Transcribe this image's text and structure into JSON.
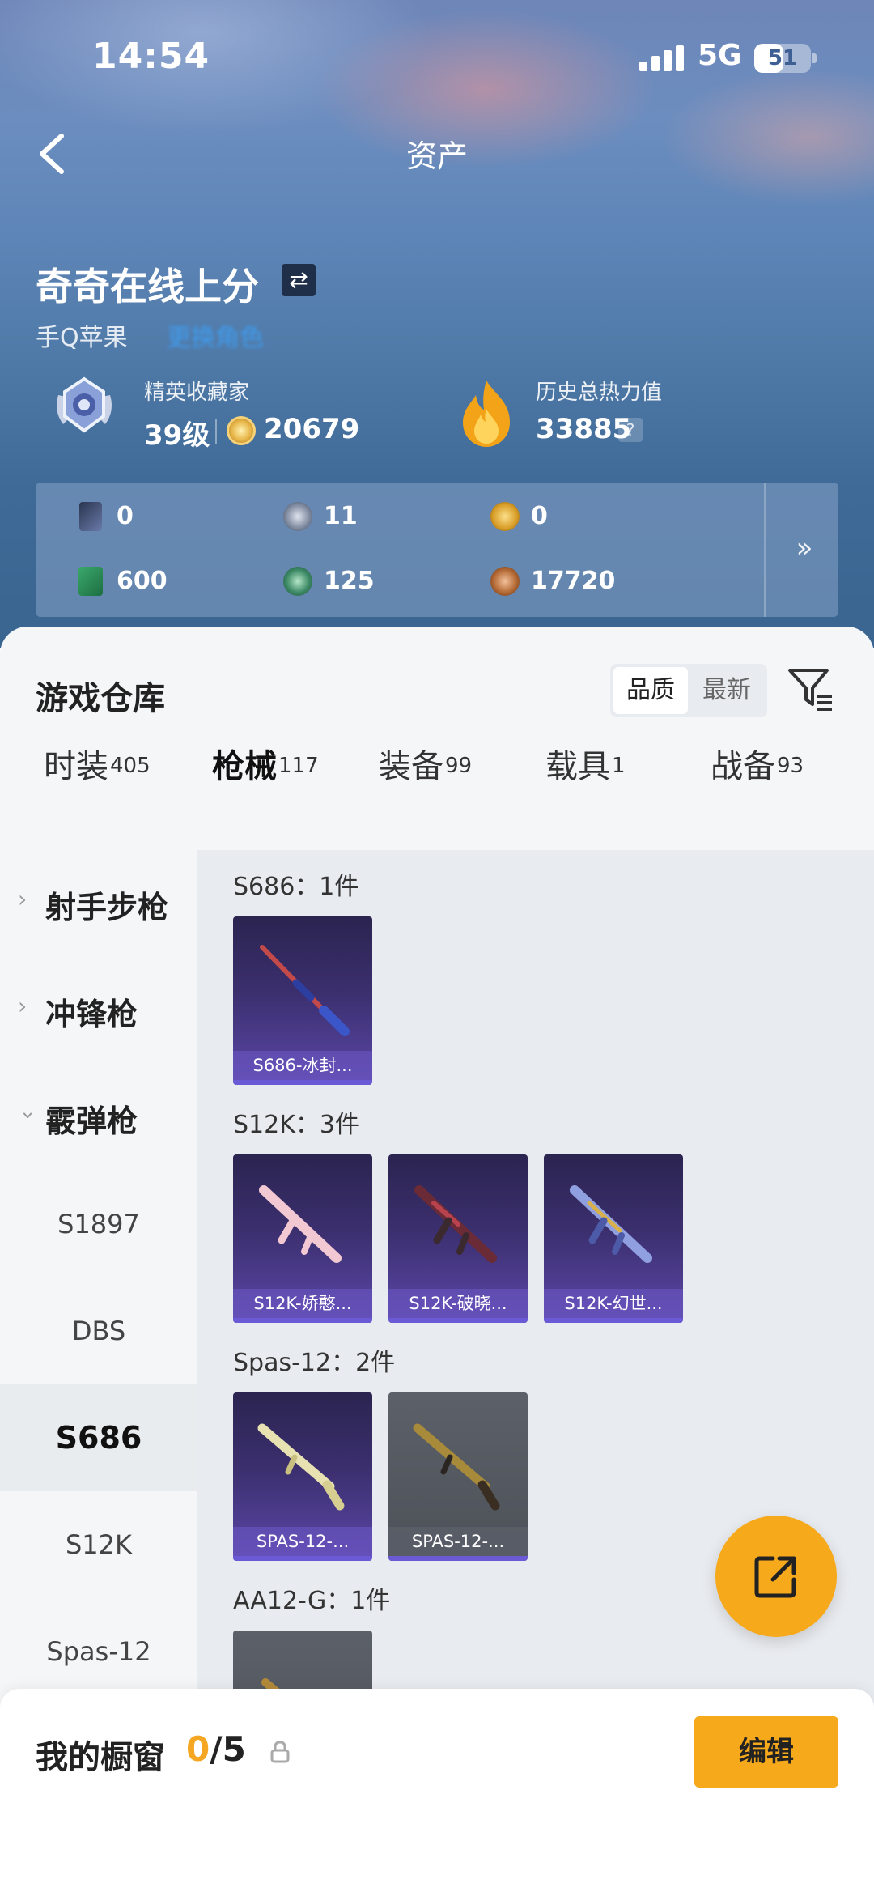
{
  "status_bar": {
    "time": "14:54",
    "network": "5G",
    "battery": "51",
    "battery_level": 0.51
  },
  "nav": {
    "title": "资产"
  },
  "profile": {
    "username": "奇奇在线上分",
    "platform": "手Q苹果",
    "platform_link": "更换角色",
    "rank_label": "精英收藏家",
    "rank_level": "39级",
    "coins": "20679",
    "heat_label": "历史总热力值",
    "heat_value": "33885",
    "heat_help": "?"
  },
  "resources": [
    {
      "icon": "card-icon",
      "value": "0"
    },
    {
      "icon": "silver-coin-icon",
      "value": "11"
    },
    {
      "icon": "gold-coin-icon",
      "value": "0"
    },
    {
      "icon": "green-ticket-icon",
      "value": "600"
    },
    {
      "icon": "green-orb-icon",
      "value": "125"
    },
    {
      "icon": "bronze-token-icon",
      "value": "17720"
    }
  ],
  "warehouse": {
    "title": "游戏仓库",
    "sort_options": [
      "品质",
      "最新"
    ],
    "tabs": [
      {
        "label": "时装",
        "count": "405"
      },
      {
        "label": "枪械",
        "count": "117"
      },
      {
        "label": "装备",
        "count": "99"
      },
      {
        "label": "载具",
        "count": "1"
      },
      {
        "label": "战备",
        "count": "93"
      }
    ],
    "sidebar_groups": [
      "射手步枪",
      "冲锋枪",
      "霰弹枪"
    ],
    "sidebar_subitems": [
      "S1897",
      "DBS",
      "S686",
      "S12K",
      "Spas-12"
    ],
    "groups": [
      {
        "title": "S686：1件",
        "items": [
          "S686-冰封..."
        ]
      },
      {
        "title": "S12K：3件",
        "items": [
          "S12K-娇憨...",
          "S12K-破晓...",
          "S12K-幻世..."
        ]
      },
      {
        "title": "Spas-12：2件",
        "items": [
          "SPAS-12-...",
          "SPAS-12-..."
        ]
      },
      {
        "title": "AA12-G：1件",
        "items": [
          ""
        ]
      }
    ]
  },
  "showcase": {
    "title": "我的橱窗",
    "current": "0",
    "total": "/5",
    "edit_label": "编辑"
  },
  "colors": {
    "accent": "#f7a91c",
    "card_purple": "#3b2f6e",
    "card_grey": "#565b62"
  }
}
